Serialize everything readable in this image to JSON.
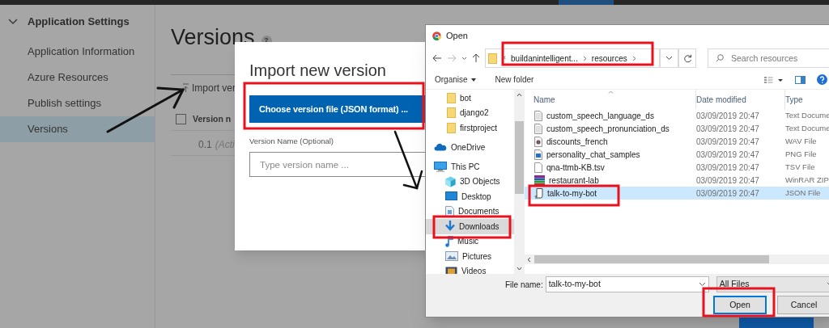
{
  "sidebar": {
    "section": {
      "title": "Application Settings",
      "expanded": true
    },
    "items": [
      {
        "label": "Application Information",
        "selected": false
      },
      {
        "label": "Azure Resources",
        "selected": false
      },
      {
        "label": "Publish settings",
        "selected": false
      },
      {
        "label": "Versions",
        "selected": true
      }
    ]
  },
  "page": {
    "title": "Versions",
    "help_badge": "?",
    "import_action": "Import ver",
    "table": {
      "select_all": {
        "checked": false
      },
      "columns": [
        "Version n"
      ],
      "rows": [
        {
          "version": "0.1",
          "status": "(Acti"
        }
      ]
    }
  },
  "import_dialog": {
    "title": "Import new version",
    "choose_button": "Choose version file (JSON format) ...",
    "name_field": {
      "label": "Version Name (Optional)",
      "placeholder": "Type version name ..."
    }
  },
  "open_dialog": {
    "title": "Open",
    "address": {
      "overflow": "«",
      "crumbs": [
        "buildanintelligent...",
        "resources"
      ]
    },
    "search": {
      "placeholder": "Search resources"
    },
    "toolbar": [
      "Organise",
      "New folder"
    ],
    "nav": [
      {
        "label": "bot",
        "kind": "folder",
        "selected": false
      },
      {
        "label": "django2",
        "kind": "folder",
        "selected": false
      },
      {
        "label": "firstproject",
        "kind": "folder",
        "selected": false
      },
      {
        "label": "OneDrive",
        "kind": "cloud",
        "selected": false
      },
      {
        "label": "This PC",
        "kind": "pc",
        "selected": false,
        "children": [
          {
            "label": "3D Objects",
            "kind": "cube",
            "selected": false
          },
          {
            "label": "Desktop",
            "kind": "desktop",
            "selected": false
          },
          {
            "label": "Documents",
            "kind": "documents",
            "selected": false
          },
          {
            "label": "Downloads",
            "kind": "downloads",
            "selected": true
          },
          {
            "label": "Music",
            "kind": "music",
            "selected": false
          },
          {
            "label": "Pictures",
            "kind": "pictures",
            "selected": false
          },
          {
            "label": "Videos",
            "kind": "videos",
            "selected": false
          }
        ]
      }
    ],
    "columns": [
      "Name",
      "Date modified",
      "Type"
    ],
    "files": [
      {
        "name": "custom_speech_language_ds",
        "date": "03/09/2019 20:47",
        "type": "Text Docume",
        "kind": "text",
        "selected": false
      },
      {
        "name": "custom_speech_pronunciation_ds",
        "date": "03/09/2019 20:47",
        "type": "Text Docume",
        "kind": "text",
        "selected": false
      },
      {
        "name": "discounts_french",
        "date": "03/09/2019 20:47",
        "type": "WAV File",
        "kind": "audio",
        "selected": false
      },
      {
        "name": "personality_chat_samples",
        "date": "03/09/2019 20:47",
        "type": "PNG File",
        "kind": "image",
        "selected": false
      },
      {
        "name": "qna-ttmb-KB.tsv",
        "date": "03/09/2019 20:47",
        "type": "TSV File",
        "kind": "blank",
        "selected": false
      },
      {
        "name": "restaurant-lab",
        "date": "03/09/2019 20:47",
        "type": "WinRAR ZIP",
        "kind": "archive",
        "selected": false
      },
      {
        "name": "talk-to-my-bot",
        "date": "03/09/2019 20:47",
        "type": "JSON File",
        "kind": "script",
        "selected": true
      }
    ],
    "file_name": {
      "label": "File name:",
      "value": "talk-to-my-bot"
    },
    "file_type": "All Files",
    "buttons": [
      {
        "label": "Open",
        "default": true
      },
      {
        "label": "Cancel",
        "default": false
      }
    ]
  }
}
